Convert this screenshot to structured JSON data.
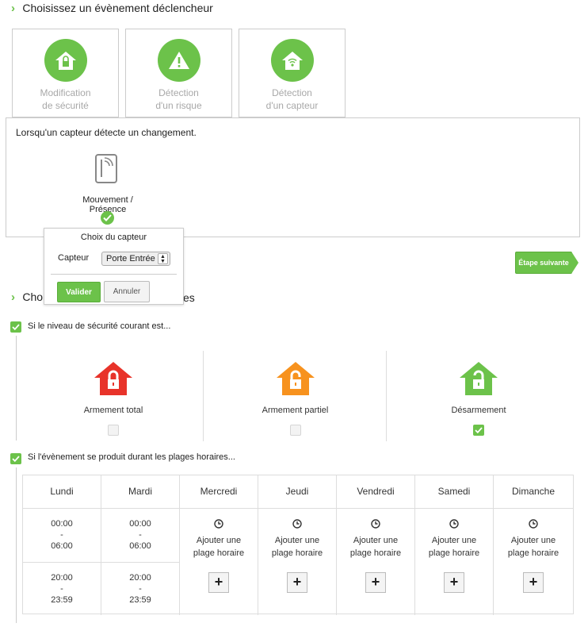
{
  "section1": {
    "title": "Choisissez un évènement déclencheur"
  },
  "triggers": [
    {
      "line1": "Modification",
      "line2": "de sécurité",
      "icon": "house-lock-icon"
    },
    {
      "line1": "Détection",
      "line2": "d'un risque",
      "icon": "warning-icon"
    },
    {
      "line1": "Détection",
      "line2": "d'un capteur",
      "icon": "house-signal-icon"
    }
  ],
  "panel": {
    "description": "Lorsqu'un capteur détecte un changement.",
    "sensor_label": "Mouvement / Présence"
  },
  "popup": {
    "title": "Choix du capteur",
    "field_label": "Capteur",
    "selected": "Porte Entrée",
    "validate": "Valider",
    "cancel": "Annuler"
  },
  "next_button": "Étape suivante",
  "section2": {
    "title_start": "Cho",
    "title_end": "es"
  },
  "condition1": {
    "label": "Si le niveau de sécurité courant est...",
    "levels": [
      {
        "label": "Armement total",
        "color": "#e8332a",
        "checked": false
      },
      {
        "label": "Armement partiel",
        "color": "#f7921e",
        "checked": false
      },
      {
        "label": "Désarmement",
        "color": "#6cc24a",
        "checked": true
      }
    ]
  },
  "condition2": {
    "label": "Si l'évènement se produit durant les plages horaires...",
    "days": [
      "Lundi",
      "Mardi",
      "Mercredi",
      "Jeudi",
      "Vendredi",
      "Samedi",
      "Dimanche"
    ],
    "slots": {
      "lundi": [
        {
          "start": "00:00",
          "sep": "-",
          "end": "06:00"
        },
        {
          "start": "20:00",
          "sep": "-",
          "end": "23:59"
        }
      ],
      "mardi": [
        {
          "start": "00:00",
          "sep": "-",
          "end": "06:00"
        },
        {
          "start": "20:00",
          "sep": "-",
          "end": "23:59"
        }
      ]
    },
    "add_line1": "Ajouter une",
    "add_line2": "plage horaire",
    "plus": "+"
  },
  "colors": {
    "accent": "#6cc24a",
    "danger": "#e8332a",
    "warning": "#f7921e"
  }
}
